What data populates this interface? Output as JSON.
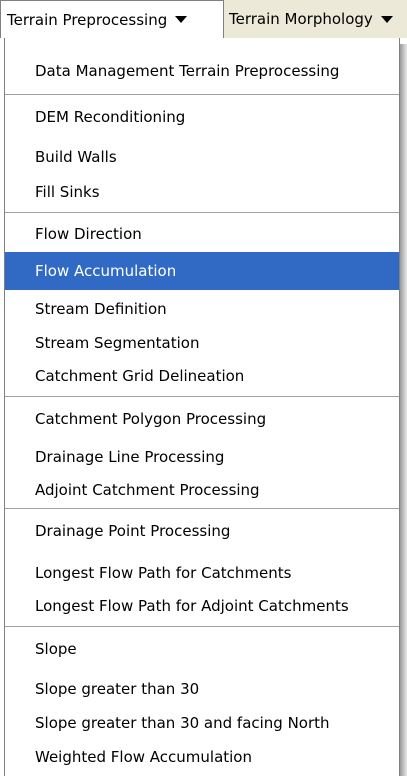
{
  "menubar": {
    "open_menu": "Terrain Preprocessing",
    "next_menu": "Terrain Morphology"
  },
  "menu": {
    "selected": "Flow Accumulation",
    "items": [
      "Data Management Terrain Preprocessing",
      "DEM Reconditioning",
      "Build Walls",
      "Fill Sinks",
      "Flow Direction",
      "Flow Accumulation",
      "Stream Definition",
      "Stream Segmentation",
      "Catchment Grid Delineation",
      "Catchment Polygon Processing",
      "Drainage Line Processing",
      "Adjoint Catchment Processing",
      "Drainage Point Processing",
      "Longest Flow Path for Catchments",
      "Longest Flow Path for Adjoint Catchments",
      "Slope",
      "Slope greater than 30",
      "Slope greater than 30 and facing North",
      "Weighted Flow Accumulation"
    ]
  }
}
